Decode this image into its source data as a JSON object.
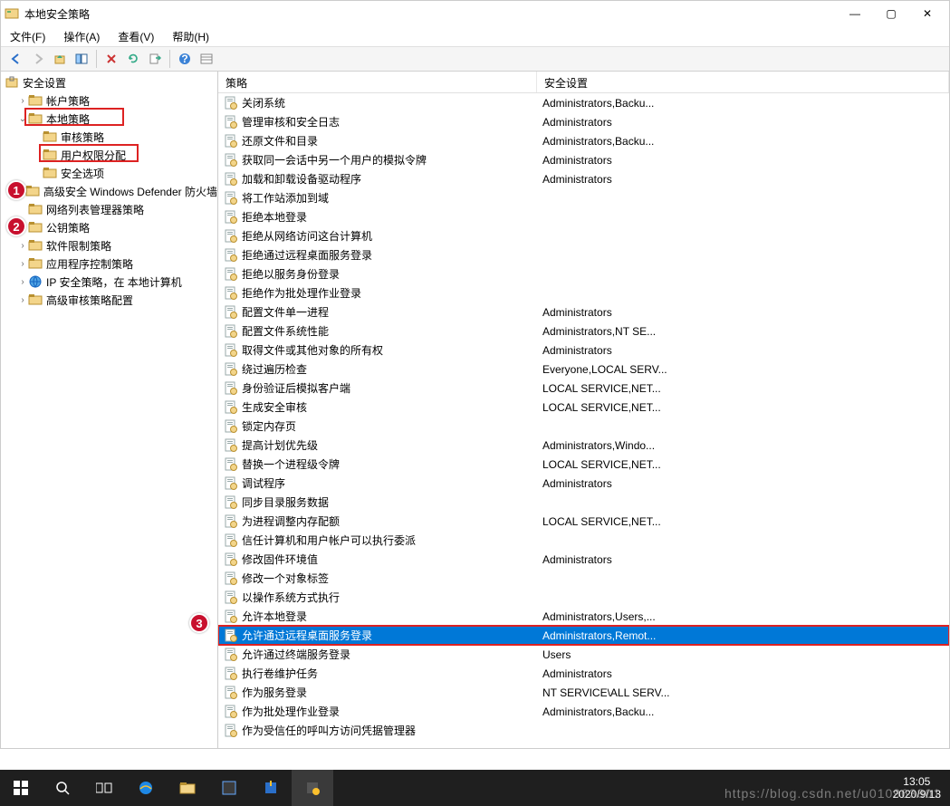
{
  "window": {
    "title": "本地安全策略",
    "controls": {
      "min": "—",
      "max": "▢",
      "close": "✕"
    }
  },
  "menubar": [
    "文件(F)",
    "操作(A)",
    "查看(V)",
    "帮助(H)"
  ],
  "toolbar_icons": [
    "back",
    "forward",
    "up",
    "show-hide",
    "delete",
    "refresh",
    "export",
    "help",
    "list"
  ],
  "tree": {
    "root": "安全设置",
    "items": [
      {
        "label": "帐户策略",
        "indent": 1,
        "exp": ">",
        "icon": "folder"
      },
      {
        "label": "本地策略",
        "indent": 1,
        "exp": "v",
        "icon": "folder",
        "hl": 1
      },
      {
        "label": "审核策略",
        "indent": 2,
        "exp": "",
        "icon": "folder"
      },
      {
        "label": "用户权限分配",
        "indent": 2,
        "exp": "",
        "icon": "folder",
        "hl": 2
      },
      {
        "label": "安全选项",
        "indent": 2,
        "exp": "",
        "icon": "folder"
      },
      {
        "label": "高级安全 Windows Defender 防火墙",
        "indent": 1,
        "exp": ">",
        "icon": "folder"
      },
      {
        "label": "网络列表管理器策略",
        "indent": 1,
        "exp": "",
        "icon": "folder"
      },
      {
        "label": "公钥策略",
        "indent": 1,
        "exp": ">",
        "icon": "folder"
      },
      {
        "label": "软件限制策略",
        "indent": 1,
        "exp": ">",
        "icon": "folder"
      },
      {
        "label": "应用程序控制策略",
        "indent": 1,
        "exp": ">",
        "icon": "folder"
      },
      {
        "label": "IP 安全策略，在 本地计算机",
        "indent": 1,
        "exp": ">",
        "icon": "ip"
      },
      {
        "label": "高级审核策略配置",
        "indent": 1,
        "exp": ">",
        "icon": "folder"
      }
    ]
  },
  "list": {
    "headers": {
      "policy": "策略",
      "setting": "安全设置"
    },
    "rows": [
      {
        "policy": "关闭系统",
        "setting": "Administrators,Backu..."
      },
      {
        "policy": "管理审核和安全日志",
        "setting": "Administrators"
      },
      {
        "policy": "还原文件和目录",
        "setting": "Administrators,Backu..."
      },
      {
        "policy": "获取同一会话中另一个用户的模拟令牌",
        "setting": "Administrators"
      },
      {
        "policy": "加载和卸载设备驱动程序",
        "setting": "Administrators"
      },
      {
        "policy": "将工作站添加到域",
        "setting": ""
      },
      {
        "policy": "拒绝本地登录",
        "setting": ""
      },
      {
        "policy": "拒绝从网络访问这台计算机",
        "setting": ""
      },
      {
        "policy": "拒绝通过远程桌面服务登录",
        "setting": ""
      },
      {
        "policy": "拒绝以服务身份登录",
        "setting": ""
      },
      {
        "policy": "拒绝作为批处理作业登录",
        "setting": ""
      },
      {
        "policy": "配置文件单一进程",
        "setting": "Administrators"
      },
      {
        "policy": "配置文件系统性能",
        "setting": "Administrators,NT SE..."
      },
      {
        "policy": "取得文件或其他对象的所有权",
        "setting": "Administrators"
      },
      {
        "policy": "绕过遍历检查",
        "setting": "Everyone,LOCAL SERV..."
      },
      {
        "policy": "身份验证后模拟客户端",
        "setting": "LOCAL SERVICE,NET..."
      },
      {
        "policy": "生成安全审核",
        "setting": "LOCAL SERVICE,NET..."
      },
      {
        "policy": "锁定内存页",
        "setting": ""
      },
      {
        "policy": "提高计划优先级",
        "setting": "Administrators,Windo..."
      },
      {
        "policy": "替换一个进程级令牌",
        "setting": "LOCAL SERVICE,NET..."
      },
      {
        "policy": "调试程序",
        "setting": "Administrators"
      },
      {
        "policy": "同步目录服务数据",
        "setting": ""
      },
      {
        "policy": "为进程调整内存配额",
        "setting": "LOCAL SERVICE,NET..."
      },
      {
        "policy": "信任计算机和用户帐户可以执行委派",
        "setting": ""
      },
      {
        "policy": "修改固件环境值",
        "setting": "Administrators"
      },
      {
        "policy": "修改一个对象标签",
        "setting": ""
      },
      {
        "policy": "以操作系统方式执行",
        "setting": ""
      },
      {
        "policy": "允许本地登录",
        "setting": "Administrators,Users,..."
      },
      {
        "policy": "允许通过远程桌面服务登录",
        "setting": "Administrators,Remot...",
        "selected": true,
        "hl": 3
      },
      {
        "policy": "允许通过终端服务登录",
        "setting": "Users"
      },
      {
        "policy": "执行卷维护任务",
        "setting": "Administrators"
      },
      {
        "policy": "作为服务登录",
        "setting": "NT SERVICE\\ALL SERV..."
      },
      {
        "policy": "作为批处理作业登录",
        "setting": "Administrators,Backu..."
      },
      {
        "policy": "作为受信任的呼叫方访问凭据管理器",
        "setting": ""
      }
    ]
  },
  "badges": [
    "1",
    "2",
    "3"
  ],
  "taskbar": {
    "clock_time": "13:05",
    "clock_date": "2020/9/13"
  },
  "watermark": "https://blog.csdn.net/u010963801"
}
